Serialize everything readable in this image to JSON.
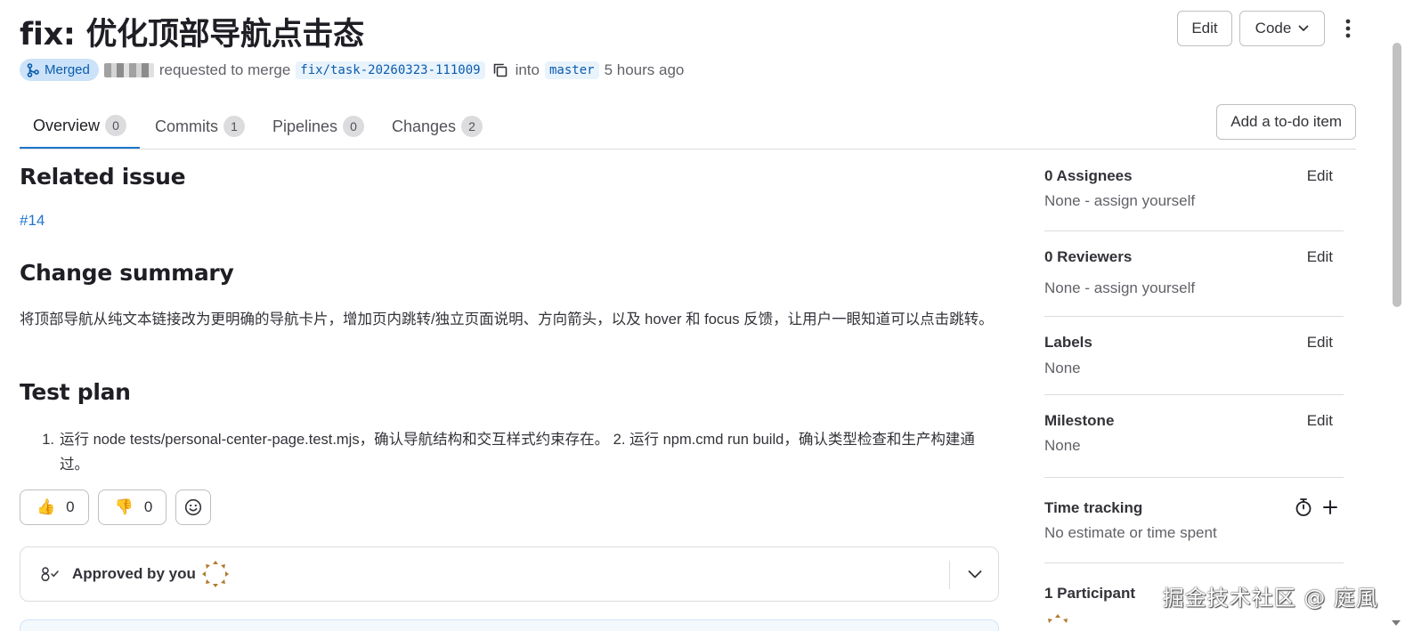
{
  "page": {
    "title": "fix: 优化顶部导航点击态",
    "actions": {
      "edit_label": "Edit",
      "code_label": "Code"
    }
  },
  "meta": {
    "status": "Merged",
    "requested_text": "requested to merge",
    "source_branch": "fix/task-20260323-111009",
    "into_text": "into",
    "target_branch": "master",
    "time_ago": "5 hours ago"
  },
  "tabs": [
    {
      "label": "Overview",
      "count": "0"
    },
    {
      "label": "Commits",
      "count": "1"
    },
    {
      "label": "Pipelines",
      "count": "0"
    },
    {
      "label": "Changes",
      "count": "2"
    }
  ],
  "todo_label": "Add a to-do item",
  "description": {
    "related_heading": "Related issue",
    "issue_link": "#14",
    "summary_heading": "Change summary",
    "summary_text": "将顶部导航从纯文本链接改为更明确的导航卡片，增加页内跳转/独立页面说明、方向箭头，以及 hover 和 focus 反馈，让用户一眼知道可以点击跳转。",
    "test_heading": "Test plan",
    "test_num": "1.",
    "test_text": "运行 node tests/personal-center-page.test.mjs，确认导航结构和交互样式约束存在。 2. 运行 npm.cmd run build，确认类型检查和生产构建通过。"
  },
  "reactions": {
    "thumbs_up": "0",
    "thumbs_down": "0"
  },
  "approval": {
    "text": "Approved by you"
  },
  "sidebar": {
    "assignees": {
      "title": "0 Assignees",
      "edit": "Edit",
      "value": "None - assign yourself"
    },
    "reviewers": {
      "title": "0 Reviewers",
      "edit": "Edit",
      "value": "None - assign yourself"
    },
    "labels": {
      "title": "Labels",
      "edit": "Edit",
      "value": "None"
    },
    "milestone": {
      "title": "Milestone",
      "edit": "Edit",
      "value": "None"
    },
    "time_tracking": {
      "title": "Time tracking",
      "value": "No estimate or time spent"
    },
    "participants": {
      "title": "1 Participant"
    }
  },
  "watermark": "掘金技术社区 @ 庭風",
  "colors": {
    "accent": "#1f75cb",
    "merged_badge_bg": "#cbe2f9",
    "merged_badge_text": "#0b5cad"
  }
}
